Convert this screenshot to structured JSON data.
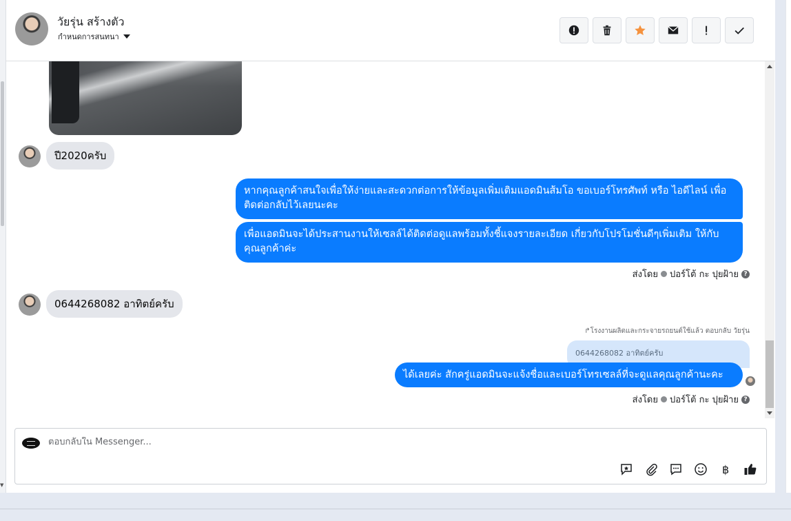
{
  "header": {
    "contact_name": "วัยรุ่น สร้างตัว",
    "subtitle": "กำหนดการสนทนา",
    "actions": [
      {
        "name": "report-button",
        "icon": "alert-circle-icon"
      },
      {
        "name": "delete-button",
        "icon": "trash-icon"
      },
      {
        "name": "star-button",
        "icon": "star-icon"
      },
      {
        "name": "mail-button",
        "icon": "envelope-icon"
      },
      {
        "name": "important-button",
        "icon": "exclamation-icon"
      },
      {
        "name": "done-button",
        "icon": "check-icon"
      }
    ]
  },
  "messages": {
    "in1": "ปี2020ครับ",
    "out1": "หากคุณลูกค้าสนใจเพื่อให้ง่ายและสะดวกต่อการให้ข้อมูลเพิ่มเติมแอดมินส้มโอ ขอเบอร์โทรศัพท์ หรือ ไอดีไลน์ เพื่อติดต่อกลับไว้เลยนะคะ",
    "out2": "เพื่อแอดมินจะได้ประสานงานให้เซลล์ได้ติดต่อดูแลพร้อมทั้งชี้แจงรายละเอียด เกี่ยวกับโปรโมชั่นดีๆเพิ่มเติม ให้กับคุณลูกค้าค่ะ",
    "sent_by_1": "ส่งโดย",
    "sender_1": "ปอร์โต้ กะ ปุยฝ้าย",
    "in2": "0644268082 อาทิตย์ครับ",
    "reply_note": "โรงงานผลิตและกระจายรถยนต์ใช้แล้ว ตอบกลับ วัยรุ่น",
    "quoted": "0644268082 อาทิตย์ครับ",
    "out3": "ได้เลยค่ะ สักครู่แอดมินจะแจ้งชื่อและเบอร์โทรเซลล์ที่จะดูแลคุณลูกค้านะคะ",
    "sent_by_2": "ส่งโดย",
    "sender_2": "ปอร์โต้ กะ ปุยฝ้าย"
  },
  "composer": {
    "placeholder": "ตอบกลับใน Messenger...",
    "tools": [
      "saved-reply-icon",
      "attachment-icon",
      "chat-bubble-icon",
      "emoji-icon",
      "baht-icon",
      "like-icon"
    ]
  },
  "colors": {
    "outgoing_bubble": "#0a7cff",
    "incoming_bubble": "#e4e6eb",
    "star": "#f5923e"
  }
}
